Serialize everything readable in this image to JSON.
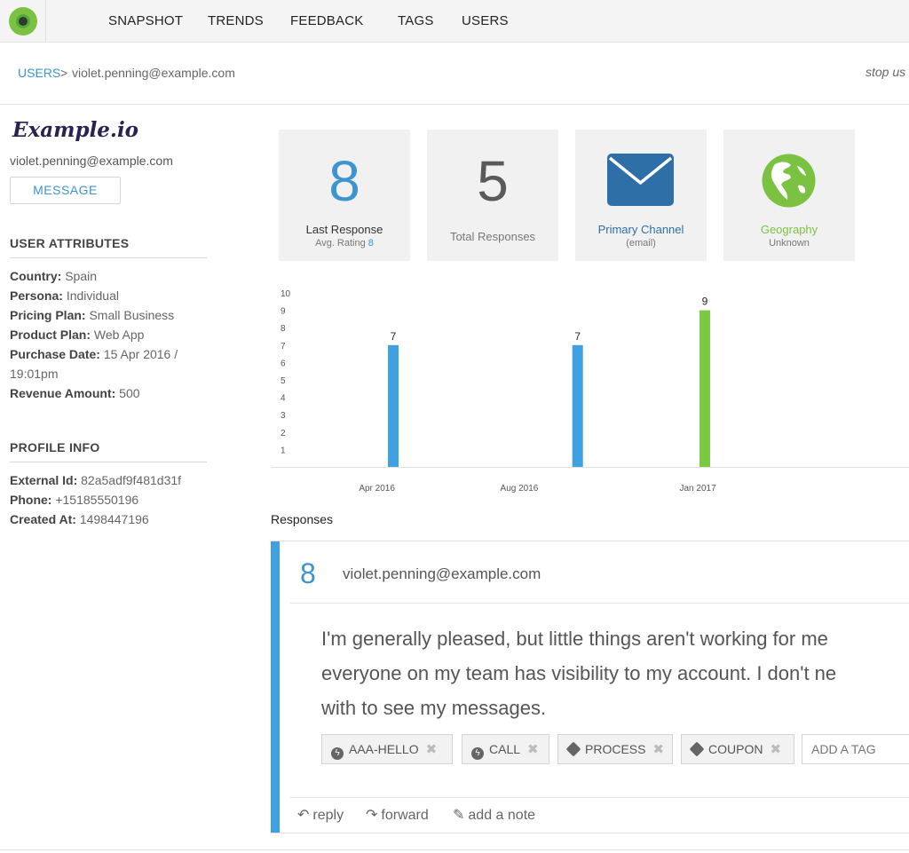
{
  "nav": {
    "items": [
      "SNAPSHOT",
      "TRENDS",
      "FEEDBACK",
      "TAGS",
      "USERS"
    ]
  },
  "breadcrumb": {
    "parent": "USERS",
    "separator": ">",
    "current": "violet.penning@example.com",
    "right_action": "stop us"
  },
  "sidebar": {
    "brand": "Example.io",
    "email": "violet.penning@example.com",
    "message_button": "MESSAGE",
    "user_attributes_title": "USER ATTRIBUTES",
    "attributes": [
      {
        "key": "Country:",
        "value": "Spain"
      },
      {
        "key": "Persona:",
        "value": "Individual"
      },
      {
        "key": "Pricing Plan:",
        "value": "Small Business"
      },
      {
        "key": "Product Plan:",
        "value": "Web App"
      },
      {
        "key": "Purchase Date:",
        "value": "15 Apr 2016 / 19:01pm"
      },
      {
        "key": "Revenue Amount:",
        "value": "500"
      }
    ],
    "profile_info_title": "PROFILE INFO",
    "profile": [
      {
        "key": "External Id:",
        "value": "82a5adf9f481d31f"
      },
      {
        "key": "Phone:",
        "value": "+15185550196"
      },
      {
        "key": "Created At:",
        "value": "1498447196"
      }
    ]
  },
  "cards": {
    "last_response": {
      "value": "8",
      "label": "Last Response",
      "sub_prefix": "Avg. Rating",
      "sub_value": "8"
    },
    "total_responses": {
      "value": "5",
      "label": "Total Responses"
    },
    "primary_channel": {
      "label": "Primary Channel",
      "sub": "(email)",
      "icon": "envelope-icon"
    },
    "geography": {
      "label": "Geography",
      "sub": "Unknown",
      "icon": "globe-icon"
    }
  },
  "colors": {
    "accent": "#3d94d1",
    "bar_blue": "#3ea2e0",
    "bar_green": "#7ac943",
    "geo_green": "#7cc242",
    "envelope": "#2f6fa8"
  },
  "chart_data": {
    "type": "bar",
    "ylim": [
      0,
      10
    ],
    "yticks": [
      1,
      2,
      3,
      4,
      5,
      6,
      7,
      8,
      9,
      10
    ],
    "xticks": [
      "Apr 2016",
      "Aug 2016",
      "Jan 2017"
    ],
    "bars": [
      {
        "date": "2016-04-15",
        "value": 7,
        "color": "#3ea2e0"
      },
      {
        "date": "2016-09-20",
        "value": 7,
        "color": "#3ea2e0"
      },
      {
        "date": "2017-01-07",
        "value": 9,
        "color": "#7ac943"
      }
    ]
  },
  "responses": {
    "heading": "Responses",
    "items": [
      {
        "score": "8",
        "email": "violet.penning@example.com",
        "text_lines": [
          "I'm generally pleased, but little things aren't working for me",
          "everyone on my team has visibility to my account. I don't ne",
          "with to see my messages."
        ],
        "tags": [
          {
            "label": "AAA-HELLO",
            "icon": "bolt-icon"
          },
          {
            "label": "CALL",
            "icon": "bolt-icon"
          },
          {
            "label": "PROCESS",
            "icon": "tag-icon"
          },
          {
            "label": "COUPON",
            "icon": "tag-icon"
          }
        ],
        "add_tag_placeholder": "ADD A TAG",
        "actions": [
          "reply",
          "forward",
          "add a note"
        ]
      }
    ]
  }
}
